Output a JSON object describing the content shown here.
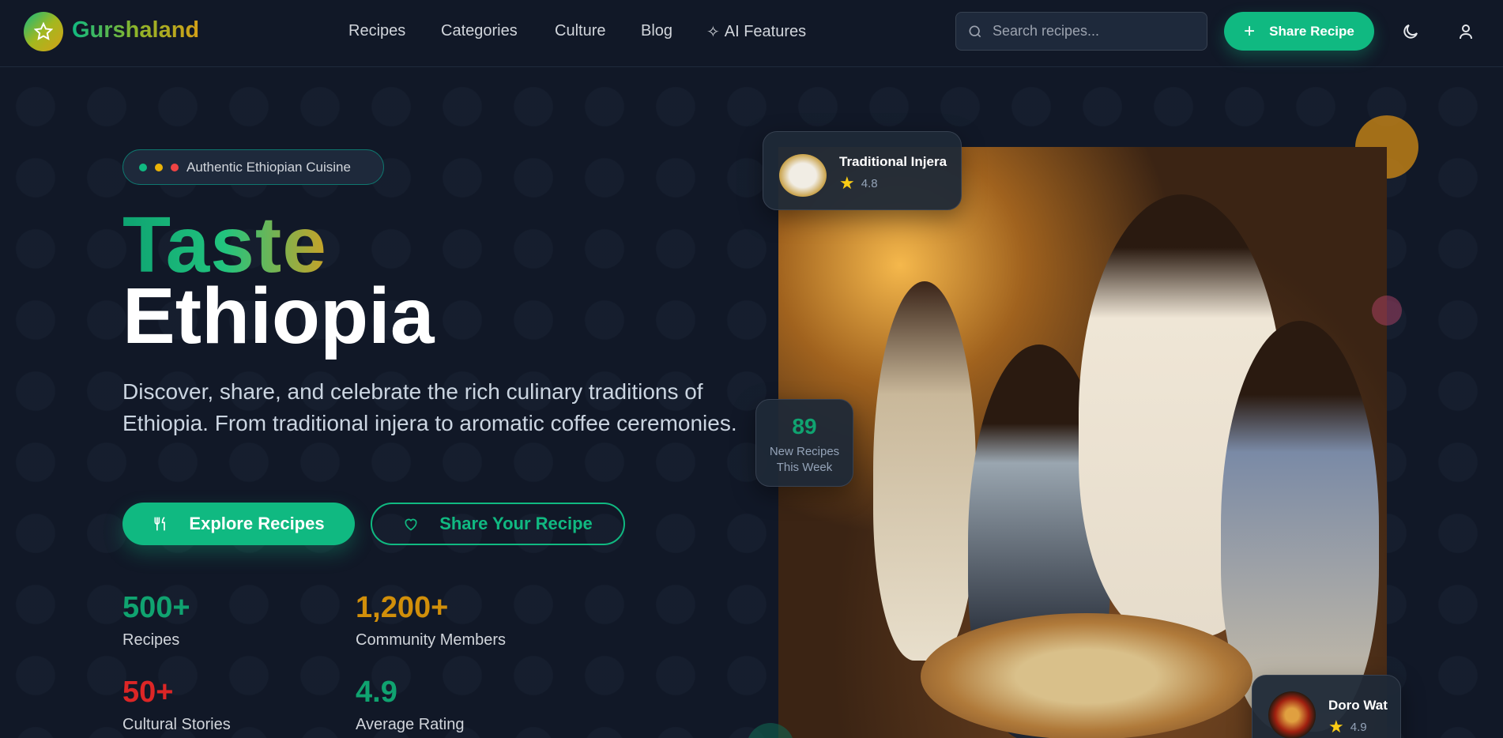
{
  "brand": {
    "name": "Gurshaland"
  },
  "nav": {
    "links": [
      "Recipes",
      "Categories",
      "Culture",
      "Blog",
      "AI Features"
    ]
  },
  "search": {
    "placeholder": "Search recipes..."
  },
  "header": {
    "share_label": "Share Recipe"
  },
  "hero": {
    "badge": "Authentic Ethiopian Cuisine",
    "title_line1": "Taste",
    "title_line2": "Ethiopia",
    "description": "Discover, share, and celebrate the rich culinary traditions of Ethiopia. From traditional injera to aromatic coffee ceremonies.",
    "explore_label": "Explore Recipes",
    "share_label": "Share Your Recipe",
    "stats": [
      {
        "value": "500+",
        "label": "Recipes",
        "color": "#10a370"
      },
      {
        "value": "1,200+",
        "label": "Community Members",
        "color": "#d18f0a"
      },
      {
        "value": "50+",
        "label": "Cultural Stories",
        "color": "#dc2626"
      },
      {
        "value": "4.9",
        "label": "Average Rating",
        "color": "#10a370"
      }
    ]
  },
  "cards": {
    "injera": {
      "title": "Traditional Injera",
      "rating": "4.8"
    },
    "new_recipes": {
      "value": "89",
      "label": "New Recipes This Week"
    },
    "doro": {
      "title": "Doro Wat",
      "rating": "4.9"
    }
  },
  "colors": {
    "accent": "#10b981",
    "background": "#111827",
    "gold": "#d4a017"
  }
}
